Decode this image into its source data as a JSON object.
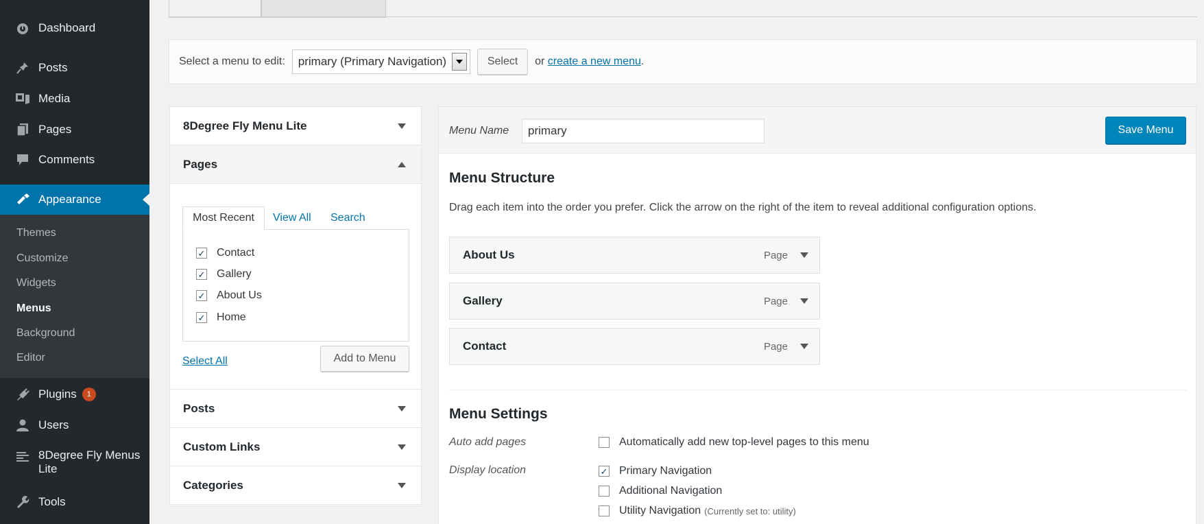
{
  "sidebar": {
    "items": [
      {
        "label": "Dashboard",
        "icon": "dashboard-icon"
      },
      {
        "label": "Posts",
        "icon": "pin-icon"
      },
      {
        "label": "Media",
        "icon": "media-icon"
      },
      {
        "label": "Pages",
        "icon": "pages-icon"
      },
      {
        "label": "Comments",
        "icon": "comment-icon"
      },
      {
        "label": "Appearance",
        "icon": "brush-icon"
      },
      {
        "label": "Plugins",
        "icon": "plug-icon",
        "badge": "1"
      },
      {
        "label": "Users",
        "icon": "user-icon"
      },
      {
        "label": "8Degree Fly Menus Lite",
        "icon": "list-icon"
      },
      {
        "label": "Tools",
        "icon": "wrench-icon"
      }
    ],
    "submenu": [
      "Themes",
      "Customize",
      "Widgets",
      "Menus",
      "Background",
      "Editor"
    ],
    "active_submenu": "Menus",
    "accent": "#0073aa",
    "background": "#23282d"
  },
  "select_bar": {
    "label": "Select a menu to edit:",
    "selected_menu": "primary (Primary Navigation)",
    "select_button": "Select",
    "or_text": "or",
    "create_link": "create a new menu",
    "period": "."
  },
  "accordion": {
    "sections": [
      {
        "title": "8Degree Fly Menu Lite",
        "open": false
      },
      {
        "title": "Pages",
        "open": true
      },
      {
        "title": "Posts",
        "open": false
      },
      {
        "title": "Custom Links",
        "open": false
      },
      {
        "title": "Categories",
        "open": false
      }
    ],
    "pages_tabs": [
      "Most Recent",
      "View All",
      "Search"
    ],
    "pages_list": [
      {
        "label": "Contact",
        "checked": true
      },
      {
        "label": "Gallery",
        "checked": true
      },
      {
        "label": "About Us",
        "checked": true
      },
      {
        "label": "Home",
        "checked": true
      }
    ],
    "select_all": "Select All",
    "add_to_menu": "Add to Menu"
  },
  "menu_editor": {
    "menu_name_label": "Menu Name",
    "menu_name_value": "primary",
    "save_button": "Save Menu",
    "structure_title": "Menu Structure",
    "instructions": "Drag each item into the order you prefer. Click the arrow on the right of the item to reveal additional configuration options.",
    "items": [
      {
        "title": "About Us",
        "type": "Page"
      },
      {
        "title": "Gallery",
        "type": "Page"
      },
      {
        "title": "Contact",
        "type": "Page"
      }
    ],
    "settings_title": "Menu Settings",
    "auto_add_label": "Auto add pages",
    "auto_add_option": {
      "label": "Automatically add new top-level pages to this menu",
      "checked": false
    },
    "display_location_label": "Display location",
    "locations": [
      {
        "label": "Primary Navigation",
        "checked": true,
        "note": ""
      },
      {
        "label": "Additional Navigation",
        "checked": false,
        "note": ""
      },
      {
        "label": "Utility Navigation",
        "checked": false,
        "note": "(Currently set to: utility)"
      }
    ]
  }
}
